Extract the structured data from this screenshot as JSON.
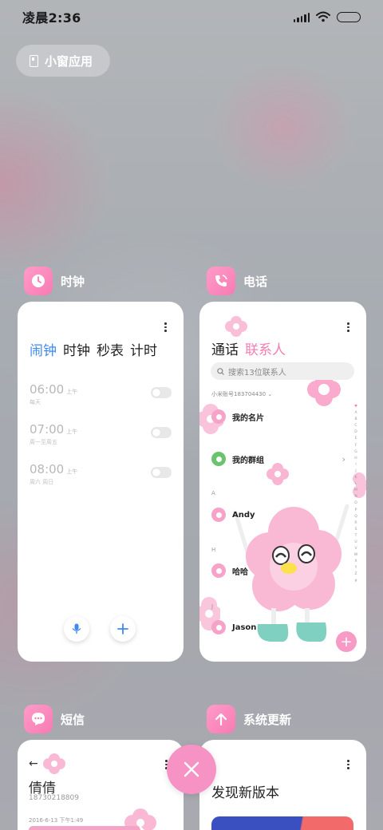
{
  "status_bar": {
    "time": "凌晨2:36"
  },
  "small_window_button": {
    "label": "小窗应用"
  },
  "apps": [
    {
      "name": "时钟",
      "tabs": [
        "闹钟",
        "时钟",
        "秒表",
        "计时"
      ],
      "alarms": [
        {
          "time": "06:00",
          "ampm": "上午",
          "repeat": "每天"
        },
        {
          "time": "07:00",
          "ampm": "上午",
          "repeat": "周一至周五"
        },
        {
          "time": "08:00",
          "ampm": "上午",
          "repeat": "周六 周日"
        }
      ]
    },
    {
      "name": "电话",
      "tabs": [
        "通话",
        "联系人"
      ],
      "search_placeholder": "搜索13位联系人",
      "account": "小米账号183704430",
      "my_card": "我的名片",
      "my_groups": "我的群组",
      "sections": [
        {
          "letter": "A",
          "contact": "Andy"
        },
        {
          "letter": "H",
          "contact": "哈哈"
        },
        {
          "letter": "J",
          "contact": "Jason"
        }
      ],
      "alphabet": [
        "♥",
        "A",
        "B",
        "C",
        "D",
        "E",
        "F",
        "G",
        "H",
        "I",
        "J",
        "K",
        "L",
        "M",
        "N",
        "O",
        "P",
        "Q",
        "R",
        "S",
        "T",
        "U",
        "V",
        "W",
        "X",
        "Y",
        "Z",
        "#"
      ],
      "fab_symbol": "+"
    },
    {
      "name": "短信",
      "contact_name": "倩倩",
      "contact_number": "18730218809",
      "message_date": "2016-6-13 下午1:49"
    },
    {
      "name": "系统更新",
      "heading": "发现新版本"
    }
  ],
  "colors": {
    "accent_pink": "#f77bb4",
    "clock_active_tab": "#3d8af0",
    "contacts_active_tab": "#f47db4"
  }
}
